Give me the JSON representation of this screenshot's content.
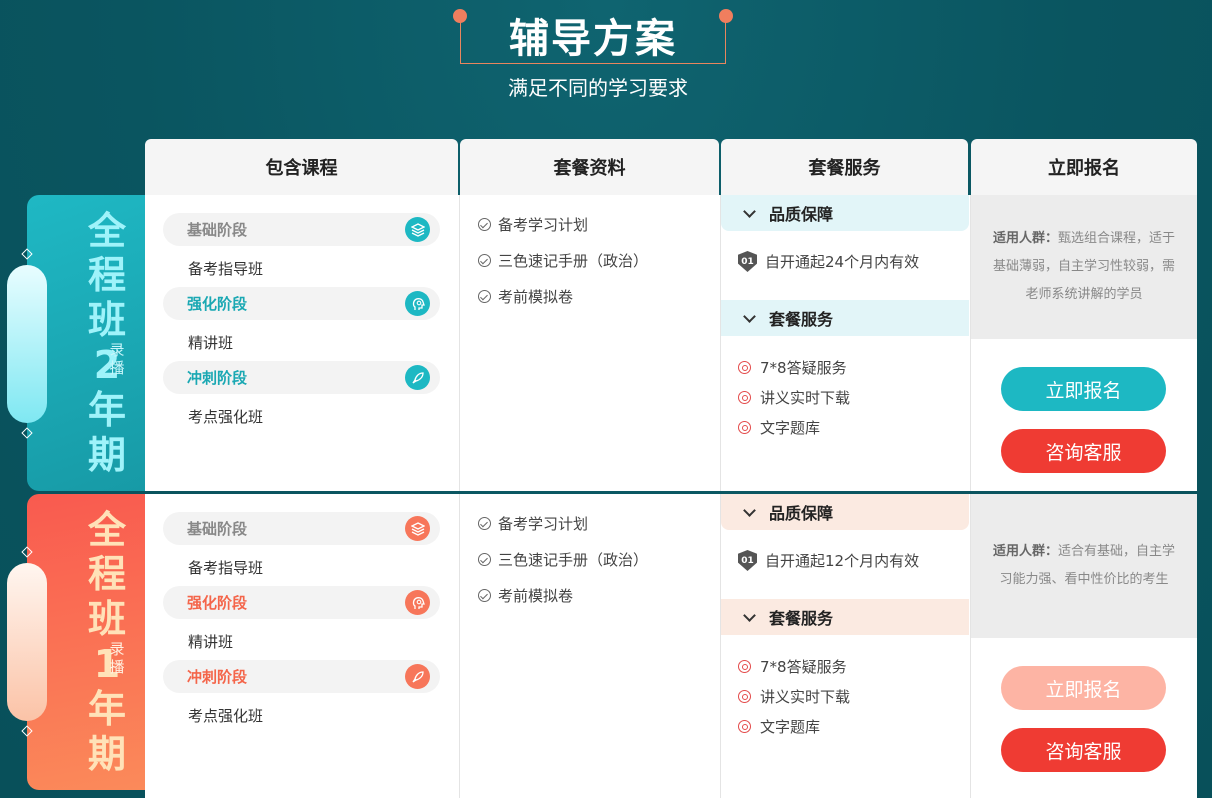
{
  "header": {
    "title": "辅导方案",
    "subtitle": "满足不同的学习要求"
  },
  "columns": [
    "包含课程",
    "套餐资料",
    "套餐服务",
    "立即报名"
  ],
  "colors": {
    "background": "#0a5560",
    "teal": "#1db8c3",
    "orange": "#f7765a",
    "red": "#ef3b33",
    "light_orange": "#fdb4a4"
  },
  "plans": [
    {
      "name_chars": [
        "全",
        "程",
        "班",
        "2",
        "年",
        "期"
      ],
      "mode_chars": [
        "录",
        "播"
      ],
      "stages": [
        {
          "label": "基础阶段",
          "course": "备考指导班",
          "icon": "layers-icon"
        },
        {
          "label": "强化阶段",
          "course": "精讲班",
          "icon": "brain-icon"
        },
        {
          "label": "冲刺阶段",
          "course": "考点强化班",
          "icon": "rocket-icon"
        }
      ],
      "materials": [
        "备考学习计划",
        "三色速记手册（政治）",
        "考前模拟卷"
      ],
      "quality_title": "品质保障",
      "validity_badge": "01",
      "validity": "自开通起24个月内有效",
      "service_title": "套餐服务",
      "services": [
        "7*8答疑服务",
        "讲义实时下载",
        "文字题库"
      ],
      "suitable_label": "适用人群：",
      "suitable_text": "甄选组合课程，适于基础薄弱，自主学习性较弱，需老师系统讲解的学员",
      "enroll_button": "立即报名",
      "consult_button": "咨询客服"
    },
    {
      "name_chars": [
        "全",
        "程",
        "班",
        "1",
        "年",
        "期"
      ],
      "mode_chars": [
        "录",
        "播"
      ],
      "stages": [
        {
          "label": "基础阶段",
          "course": "备考指导班",
          "icon": "layers-icon"
        },
        {
          "label": "强化阶段",
          "course": "精讲班",
          "icon": "brain-icon"
        },
        {
          "label": "冲刺阶段",
          "course": "考点强化班",
          "icon": "rocket-icon"
        }
      ],
      "materials": [
        "备考学习计划",
        "三色速记手册（政治）",
        "考前模拟卷"
      ],
      "quality_title": "品质保障",
      "validity_badge": "01",
      "validity": "自开通起12个月内有效",
      "service_title": "套餐服务",
      "services": [
        "7*8答疑服务",
        "讲义实时下载",
        "文字题库"
      ],
      "suitable_label": "适用人群：",
      "suitable_text": "适合有基础，自主学习能力强、看中性价比的考生",
      "enroll_button": "立即报名",
      "consult_button": "咨询客服"
    }
  ]
}
